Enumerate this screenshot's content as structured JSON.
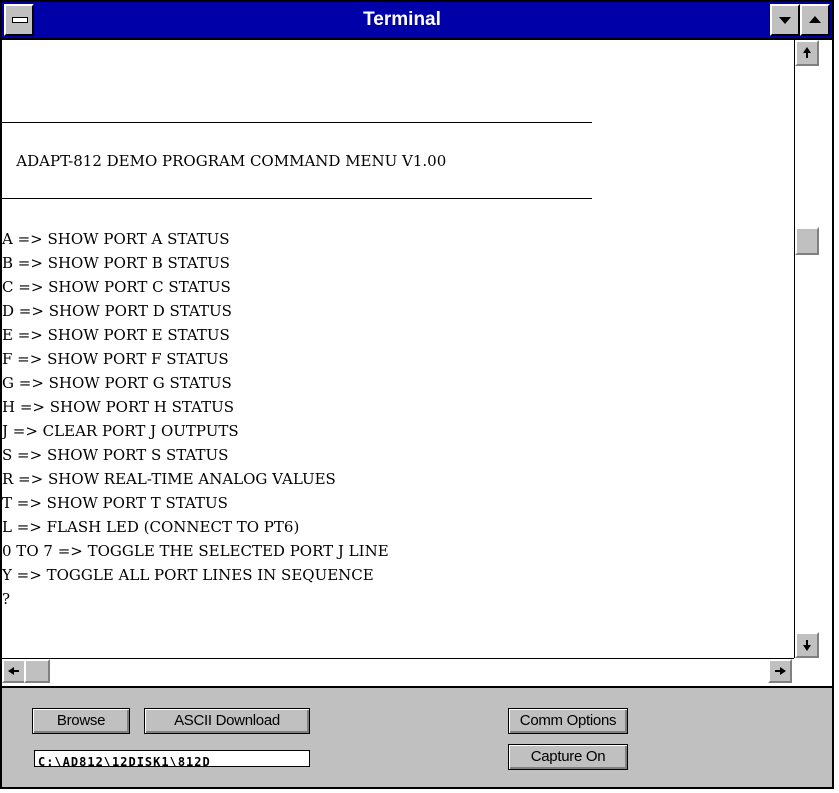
{
  "window": {
    "title": "Terminal"
  },
  "terminal": {
    "header": "   ADAPT-812 DEMO PROGRAM COMMAND MENU V1.00",
    "menu_lines": [
      "A => SHOW PORT A STATUS",
      "B => SHOW PORT B STATUS",
      "C => SHOW PORT C STATUS",
      "D => SHOW PORT D STATUS",
      "E => SHOW PORT E STATUS",
      "F => SHOW PORT F STATUS",
      "G => SHOW PORT G STATUS",
      "H => SHOW PORT H STATUS",
      "J => CLEAR PORT J OUTPUTS",
      "S => SHOW PORT S STATUS",
      "R => SHOW REAL-TIME ANALOG VALUES",
      "T => SHOW PORT T STATUS",
      "L => FLASH LED (CONNECT TO PT6)",
      "0 TO 7 => TOGGLE THE SELECTED PORT J LINE",
      "Y => TOGGLE ALL PORT LINES IN SEQUENCE",
      "?"
    ]
  },
  "buttons": {
    "browse": "Browse",
    "ascii_download": "ASCII Download",
    "comm_options": "Comm Options",
    "capture_on": "Capture On"
  },
  "path_field": {
    "value": "C:\\AD812\\12DISK1\\812D"
  },
  "icons": {
    "system_menu": "system-menu-icon",
    "minimize": "minimize-icon",
    "maximize": "maximize-icon",
    "scroll_up": "arrow-up-icon",
    "scroll_down": "arrow-down-icon",
    "scroll_left": "arrow-left-icon",
    "scroll_right": "arrow-right-icon"
  },
  "colors": {
    "title_bar": "#0000a8",
    "face": "#c0c0c0"
  }
}
